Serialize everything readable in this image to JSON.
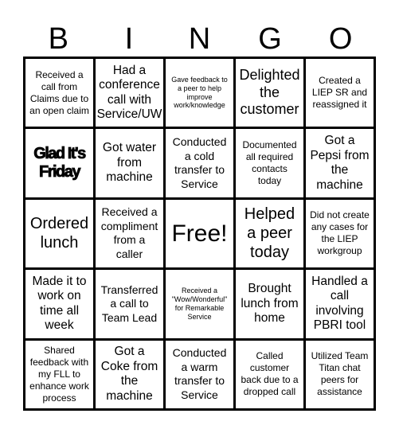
{
  "header": {
    "letters": [
      "B",
      "I",
      "N",
      "G",
      "O"
    ]
  },
  "board": {
    "rows": [
      [
        "Received a call from Claims due to an open claim",
        "Had a conference call with Service/UW",
        "Gave feedback to a peer to help improve work/knowledge",
        "Delighted the customer",
        "Created a LIEP SR and reassigned it"
      ],
      [
        "Glad It's Friday",
        "Got water from machine",
        "Conducted a cold transfer to Service",
        "Documented all required contacts today",
        "Got a Pepsi from the machine"
      ],
      [
        "Ordered lunch",
        "Received a compliment from a caller",
        "Free!",
        "Helped a peer today",
        "Did not create any cases for the LIEP workgroup"
      ],
      [
        "Made it to work on time all week",
        "Transferred a call to Team Lead",
        "Received a \"Wow/Wonderful\" for Remarkable Service",
        "Brought lunch from home",
        "Handled a call involving PBRI tool"
      ],
      [
        "Shared feedback with my FLL to enhance work process",
        "Got a Coke from the machine",
        "Conducted a warm transfer to Service",
        "Called customer back due to a dropped call",
        "Utilized Team Titan chat peers for assistance"
      ]
    ]
  }
}
